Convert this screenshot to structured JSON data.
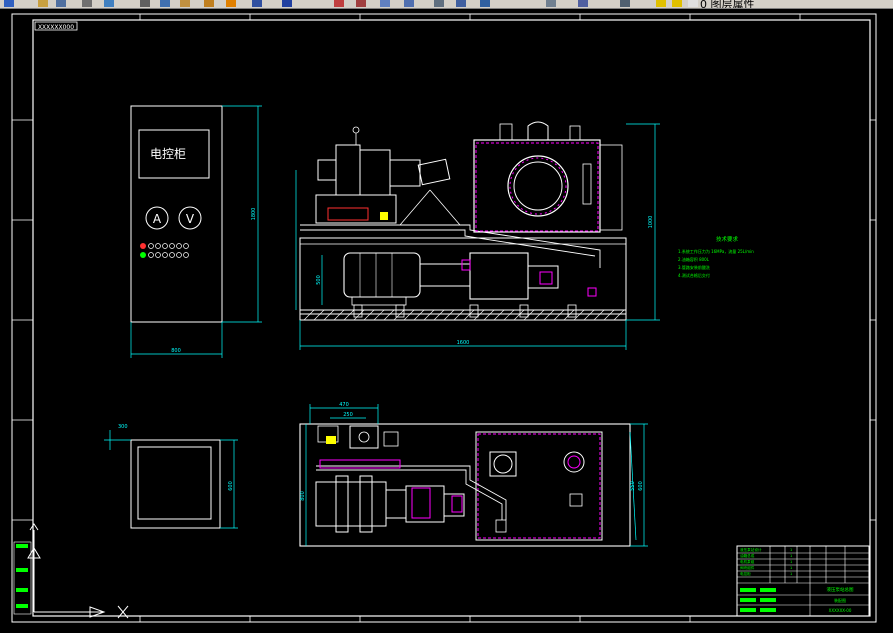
{
  "toolbar": {
    "layer_name": "0 图层属性",
    "icons": [
      "new-file-icon",
      "open-file-icon",
      "save-icon",
      "print-icon",
      "preview-icon",
      "cut-icon",
      "copy-icon",
      "paste-icon",
      "match-properties-icon",
      "undo-icon",
      "pan-icon",
      "zoom-realtime-icon",
      "zoom-window-icon",
      "zoom-previous-icon",
      "properties-icon",
      "design-center-icon",
      "tool-palette-icon",
      "calculator-icon",
      "help-icon",
      "layer-manager-icon",
      "layer-state-icon"
    ]
  },
  "drawing": {
    "drawing_number_tag": "XXXXXX000",
    "cabinet_label": "电控柜",
    "ammeter_label": "A",
    "voltmeter_label": "V",
    "cabinet_height_dim": "1800",
    "cabinet_width_dim": "800",
    "base_length_dim": "1600",
    "tank_height_dim": "1000",
    "motor_height_dim": "500",
    "plan_dim_top": "470",
    "plan_dim_top2": "250",
    "plan_dim_left": "800",
    "plan_dim_right": "600",
    "plan_dim_right2": "550",
    "small_box_dim_top": "300",
    "small_box_dim_right": "600",
    "tech_title": "技术要求",
    "tech_notes": [
      "1.系统工作压力为 16MPa，流量 25L/min",
      "2.油箱容积 800L",
      "3.管路安装前酸洗",
      "4.测试合格后交付"
    ]
  },
  "title_block": {
    "rows": [
      {
        "name": "液压泵站设计",
        "qty": "1"
      },
      {
        "name": "油箱总成",
        "qty": "1"
      },
      {
        "name": "电机泵组",
        "qty": "1"
      },
      {
        "name": "阀块组件",
        "qty": "1"
      },
      {
        "name": "电控柜",
        "qty": "1"
      }
    ],
    "title": "液压泵站总图",
    "subtitle": "装配图",
    "drawing_no": "XXXXXX-00"
  },
  "colors": {
    "cyan": "#00ffff",
    "white": "#ffffff",
    "magenta": "#ff00ff",
    "green": "#00ff00",
    "yellow": "#ffff00",
    "red": "#ff3030",
    "frame": "#ffffff"
  }
}
